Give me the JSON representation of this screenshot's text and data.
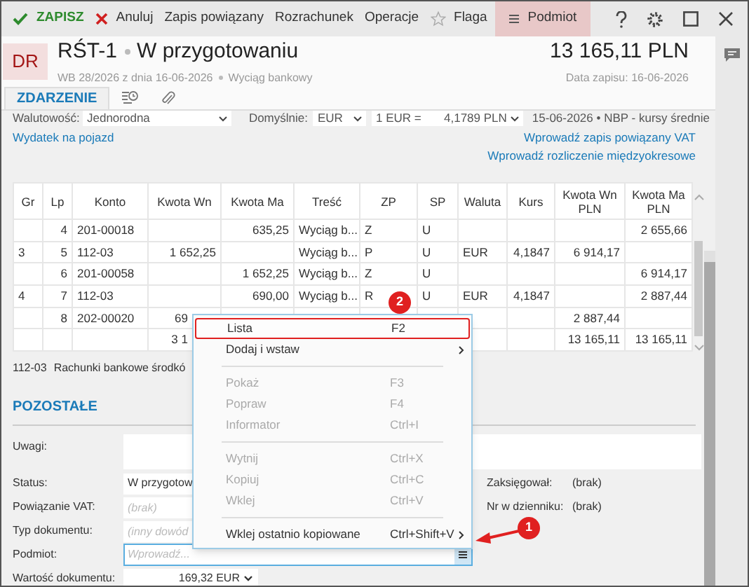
{
  "toolbar": [
    {
      "kind": "save",
      "label": "ZAPISZ",
      "active": false
    },
    {
      "kind": "cancel",
      "label": "Anuluj",
      "active": false
    },
    {
      "kind": "plain",
      "label": "Zapis powiązany",
      "active": false
    },
    {
      "kind": "plain",
      "label": "Rozrachunek",
      "active": false
    },
    {
      "kind": "plain",
      "label": "Operacje",
      "active": false
    },
    {
      "kind": "flag",
      "label": "Flaga",
      "active": false
    },
    {
      "kind": "menu",
      "label": "Podmiot",
      "active": true
    }
  ],
  "header": {
    "badge": "DR",
    "title": "RŚT-1",
    "status": "W przygotowaniu",
    "document": "WB 28/2026 z dnia 16-06-2026",
    "type": "Wyciąg bankowy",
    "amount": "13 165,11 PLN",
    "date": "Data zapisu: 16-06-2026"
  },
  "tabs": [
    {
      "kind": "text",
      "label": "ZDARZENIE",
      "selected": true
    },
    {
      "kind": "history",
      "selected": false
    },
    {
      "kind": "attachment",
      "selected": false
    }
  ],
  "currency_row": {
    "label": "Walutowość:",
    "value": "Jednorodna",
    "default_label": "Domyślnie:",
    "currency": "EUR",
    "rate_label": "1 EUR =",
    "rate": "4,1789 PLN",
    "rate_source": "15-06-2026 • NBP - kursy średnie"
  },
  "links_left": [
    "Wydatek na pojazd"
  ],
  "links_right": [
    "Wprowadź zapis powiązany VAT",
    "Wprowadź rozliczenie międzyokresowe"
  ],
  "table": {
    "columns": [
      "Gr",
      "Lp",
      "Konto",
      "Kwota Wn",
      "Kwota Ma",
      "Treść",
      "ZP",
      "SP",
      "Waluta",
      "Kurs",
      "Kwota Wn PLN",
      "Kwota Ma PLN"
    ],
    "rows": [
      [
        "",
        "4",
        "201-00018",
        "",
        "635,25",
        "Wyciąg b...",
        "Z",
        "U",
        "",
        "",
        "",
        "2 655,66"
      ],
      [
        "3",
        "5",
        "112-03",
        "1 652,25",
        "",
        "Wyciąg b...",
        "P",
        "U",
        "EUR",
        "4,1847",
        "6 914,17",
        ""
      ],
      [
        "",
        "6",
        "201-00058",
        "",
        "1 652,25",
        "Wyciąg b...",
        "Z",
        "U",
        "",
        "",
        "",
        "6 914,17"
      ],
      [
        "4",
        "7",
        "112-03",
        "",
        "690,00",
        "Wyciąg b...",
        "R",
        "U",
        "EUR",
        "4,1847",
        "",
        "2 887,44"
      ],
      [
        "",
        "8",
        "202-00020",
        {
          "text": "69",
          "cut": true
        },
        "",
        "",
        "",
        "",
        "",
        "",
        "2 887,44",
        ""
      ]
    ],
    "total": {
      "kwota_wn": {
        "text": "3 1",
        "cut": true
      },
      "kwota_wn_pln": {
        "text": "13 165,11",
        "cut": false
      },
      "kwota_ma_pln": {
        "text": "13 165,11",
        "cut": false
      }
    }
  },
  "account_note": {
    "code": "112-03",
    "name": "Rachunki bankowe środkó"
  },
  "section": "POZOSTAŁE",
  "fields": [
    {
      "kind": "textarea",
      "label": "Uwagi:"
    },
    {
      "kind": "value",
      "label": "Status:",
      "value": "W przygotow"
    },
    {
      "kind": "placeholder",
      "label": "Powiązanie VAT:",
      "placeholder": "(brak)"
    },
    {
      "kind": "placeholder",
      "label": "Typ dokumentu:",
      "placeholder": "(inny dowód"
    },
    {
      "kind": "picker",
      "label": "Podmiot:",
      "placeholder": "Wprowadź...",
      "focused": true
    },
    {
      "kind": "amount",
      "label": "Wartość dokumentu:",
      "value": "169,32 EUR"
    }
  ],
  "side_fields": [
    {
      "label": "Zaksięgował:",
      "value": "(brak)"
    },
    {
      "label": "Nr w dzienniku:",
      "value": "(brak)"
    }
  ],
  "context_menu": [
    {
      "kind": "item",
      "label": "Lista",
      "shortcut": "F2",
      "disabled": false,
      "highlighted": true,
      "submenu": false
    },
    {
      "kind": "item",
      "label": "Dodaj i wstaw",
      "disabled": false,
      "highlighted": false,
      "submenu": true
    },
    {
      "kind": "separator"
    },
    {
      "kind": "item",
      "label": "Pokaż",
      "shortcut": "F3",
      "disabled": true,
      "highlighted": false,
      "submenu": false
    },
    {
      "kind": "item",
      "label": "Popraw",
      "shortcut": "F4",
      "disabled": true,
      "highlighted": false,
      "submenu": false
    },
    {
      "kind": "item",
      "label": "Informator",
      "shortcut": "Ctrl+I",
      "disabled": true,
      "highlighted": false,
      "submenu": false
    },
    {
      "kind": "separator"
    },
    {
      "kind": "item",
      "label": "Wytnij",
      "shortcut": "Ctrl+X",
      "disabled": true,
      "highlighted": false,
      "submenu": false
    },
    {
      "kind": "item",
      "label": "Kopiuj",
      "shortcut": "Ctrl+C",
      "disabled": true,
      "highlighted": false,
      "submenu": false
    },
    {
      "kind": "item",
      "label": "Wklej",
      "shortcut": "Ctrl+V",
      "disabled": true,
      "highlighted": false,
      "submenu": false
    },
    {
      "kind": "separator"
    },
    {
      "kind": "item",
      "label": "Wklej ostatnio kopiowane",
      "shortcut": "Ctrl+Shift+V",
      "disabled": false,
      "highlighted": false,
      "submenu": true
    }
  ],
  "callouts": [
    "1",
    "2"
  ]
}
